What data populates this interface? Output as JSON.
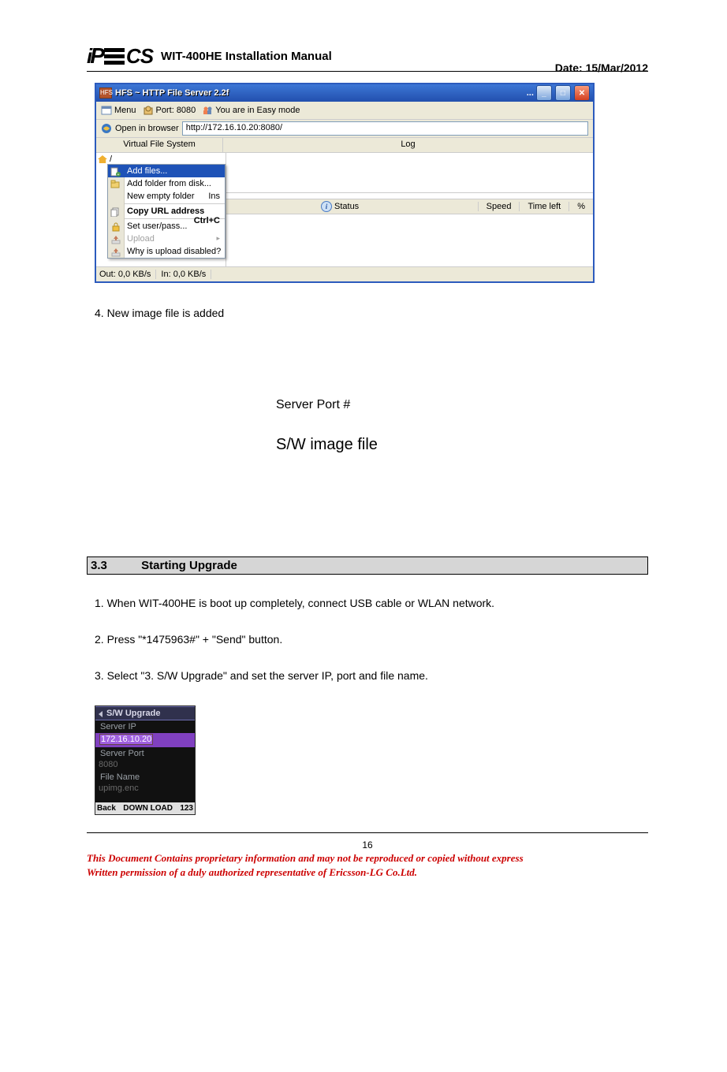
{
  "header": {
    "title": "WIT-400HE Installation Manual",
    "date": "Date: 15/Mar/2012"
  },
  "hfs": {
    "title": "HFS ~ HTTP File Server 2.2f",
    "toolbar": {
      "menu": "Menu",
      "port_label": "Port: 8080",
      "mode": "You are in Easy mode"
    },
    "open_in_browser": "Open in browser",
    "url": "http://172.16.10.20:8080/",
    "col_left": "Virtual File System",
    "col_right": "Log",
    "context_menu": {
      "add_files": "Add files...",
      "add_folder": "Add folder from disk...",
      "new_empty": "New empty folder",
      "new_empty_kb": "Ins",
      "copy_url": "Copy URL address",
      "copy_url_kb": "Ctrl+C",
      "set_user": "Set user/pass...",
      "upload": "Upload",
      "why_disabled": "Why is upload disabled?"
    },
    "status_cols": {
      "status": "Status",
      "speed": "Speed",
      "time": "Time left",
      "pct": "%"
    },
    "footer": {
      "out": "Out: 0,0 KB/s",
      "in": "In: 0,0 KB/s"
    }
  },
  "step4": "4. New image file is added",
  "annot1": "Server Port #",
  "annot2": "S/W image file",
  "section": {
    "num": "3.3",
    "title": "Starting Upgrade"
  },
  "steps": {
    "s1": "1.    When WIT-400HE is boot up completely, connect USB cable or WLAN network.",
    "s2": "2. Press \"*1475963#\" + \"Send\" button.",
    "s3": "3. Select \"3. S/W Upgrade\" and set the server IP, port and file name."
  },
  "sw": {
    "title": "S/W Upgrade",
    "server_ip_lbl": "Server IP",
    "server_ip_val": "172.16.10.20",
    "server_port_lbl": "Server Port",
    "server_port_val": "8080",
    "file_name_lbl": "File Name",
    "file_name_val": "upimg.enc",
    "back": "Back",
    "download": "DOWN LOAD",
    "mode": "123"
  },
  "page_num": "16",
  "disclaimer1": "This Document Contains proprietary information and may not be reproduced or copied without express",
  "disclaimer2": "Written permission of a duly authorized representative of Ericsson-LG Co.Ltd."
}
